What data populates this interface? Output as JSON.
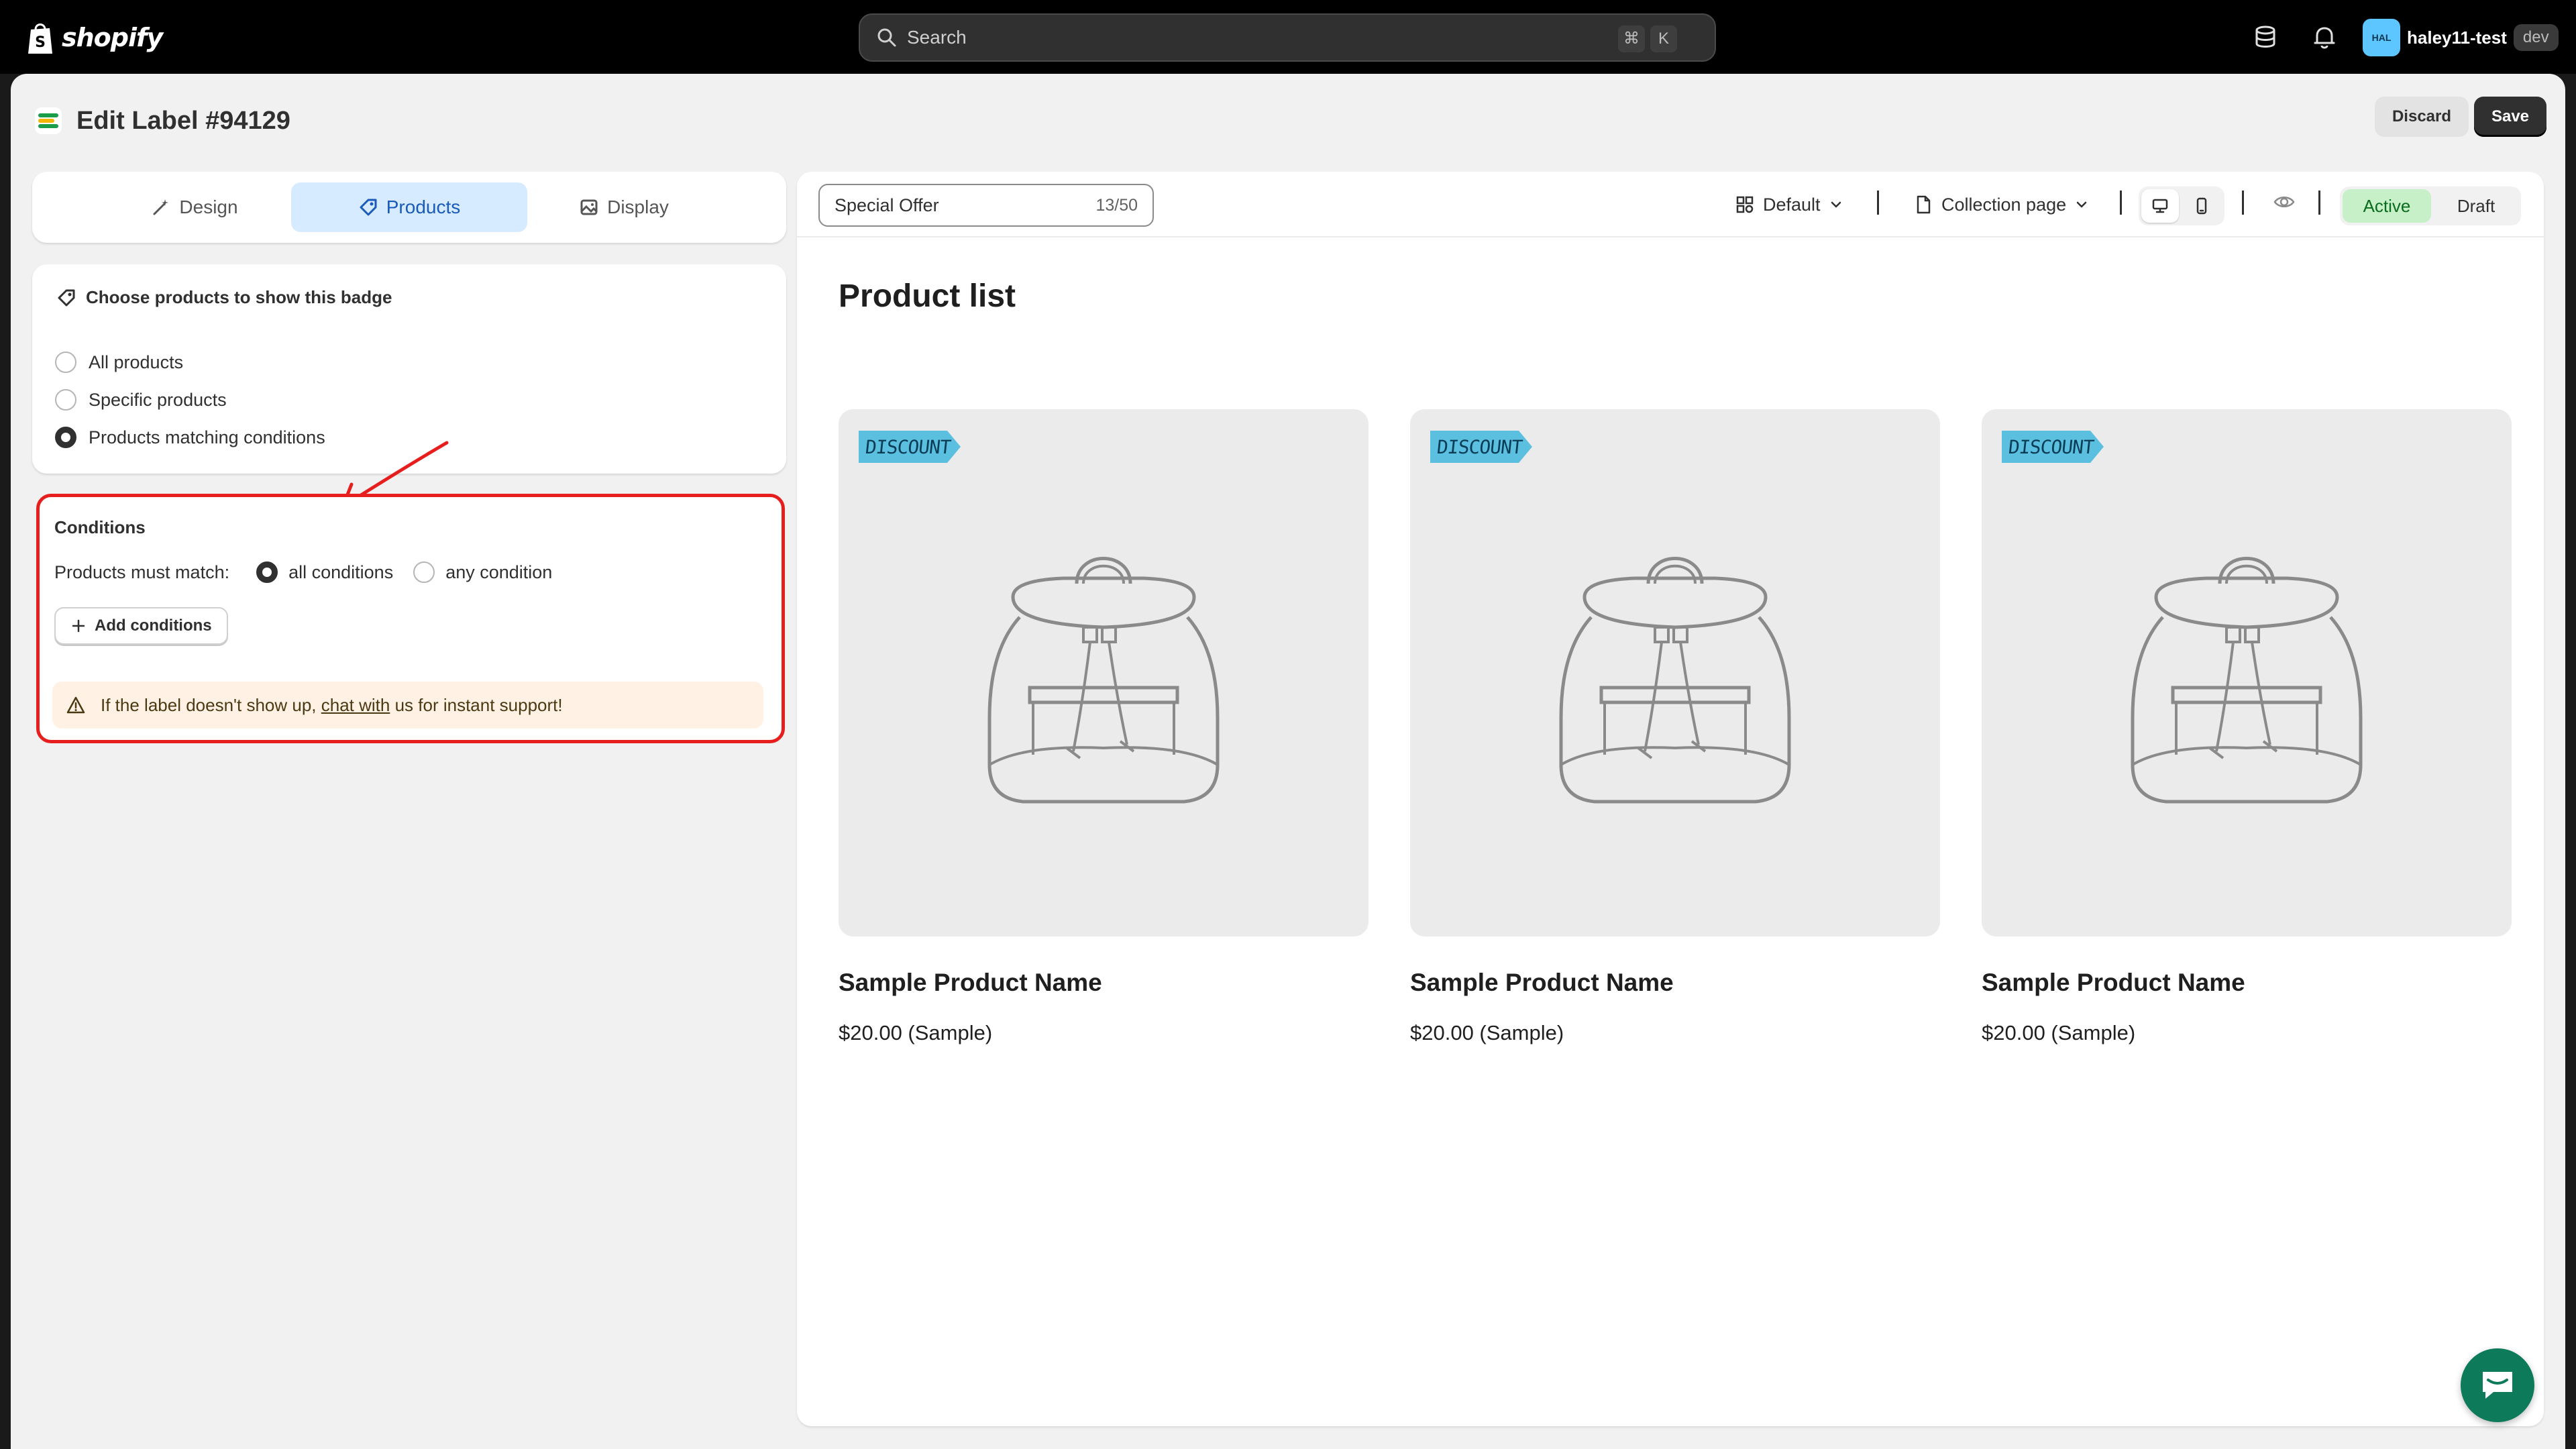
{
  "topbar": {
    "brand": "shopify",
    "search_placeholder": "Search",
    "shortcut_key1": "⌘",
    "shortcut_key2": "K",
    "avatar_initials": "HAL",
    "username": "haley11-test",
    "env_badge": "dev"
  },
  "header": {
    "title": "Edit Label #94129",
    "discard_label": "Discard",
    "save_label": "Save"
  },
  "tabs": [
    {
      "label": "Design",
      "icon": "magic-wand-icon"
    },
    {
      "label": "Products",
      "icon": "tag-icon",
      "active": true
    },
    {
      "label": "Display",
      "icon": "image-icon"
    }
  ],
  "choose": {
    "heading": "Choose products to show this badge",
    "options": [
      {
        "label": "All products",
        "selected": false
      },
      {
        "label": "Specific products",
        "selected": false
      },
      {
        "label": "Products matching conditions",
        "selected": true
      }
    ]
  },
  "conditions": {
    "title": "Conditions",
    "match_label": "Products must match:",
    "match_options": [
      {
        "label": "all conditions",
        "selected": true
      },
      {
        "label": "any condition",
        "selected": false
      }
    ],
    "add_button": "Add conditions",
    "warning_prefix": "If the label doesn't show up,",
    "warning_link": "chat with",
    "warning_suffix": "us for instant support!"
  },
  "preview": {
    "label_name": "Special Offer",
    "label_count": "13/50",
    "theme_select": "Default",
    "page_select": "Collection page",
    "status_active": "Active",
    "status_draft": "Draft",
    "list_title": "Product list",
    "products": [
      {
        "name": "Sample Product Name",
        "price": "$20.00 (Sample)",
        "badge": "DISCOUNT"
      },
      {
        "name": "Sample Product Name",
        "price": "$20.00 (Sample)",
        "badge": "DISCOUNT"
      },
      {
        "name": "Sample Product Name",
        "price": "$20.00 (Sample)",
        "badge": "DISCOUNT"
      }
    ]
  },
  "colors": {
    "accent_blue": "#d6ebff",
    "badge_blue": "#5bc0e0",
    "highlight_red": "#e61e1e",
    "active_green": "#c7f0c9",
    "chat_green": "#0d7a5a"
  }
}
